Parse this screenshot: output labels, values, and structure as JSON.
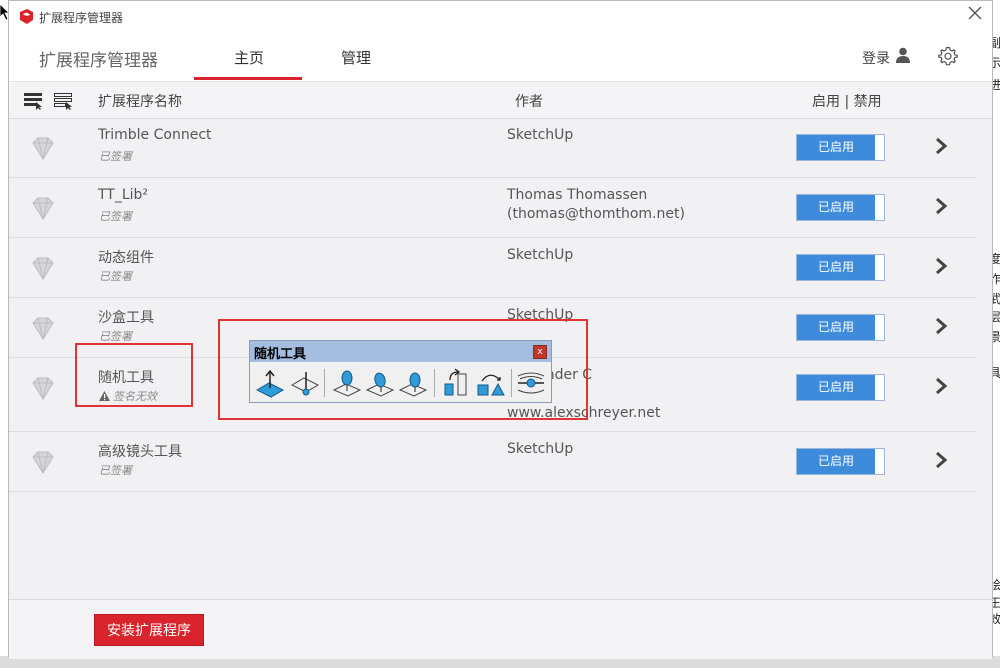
{
  "window": {
    "title": "扩展程序管理器"
  },
  "header": {
    "brand": "扩展程序管理器",
    "tabs": [
      {
        "label": "主页",
        "active": true
      },
      {
        "label": "管理",
        "active": false
      }
    ],
    "login_label": "登录"
  },
  "columns": {
    "name": "扩展程序名称",
    "author": "作者",
    "toggle": "启用 | 禁用"
  },
  "extensions": [
    {
      "name": "Trimble Connect",
      "status": "已签署",
      "author_lines": [
        "SketchUp"
      ],
      "toggle_label": "已启用"
    },
    {
      "name": "TT_Lib²",
      "status": "已签署",
      "author_lines": [
        "Thomas Thomassen",
        "(thomas@thomthom.net)"
      ],
      "toggle_label": "已启用"
    },
    {
      "name": "动态组件",
      "status": "已签署",
      "author_lines": [
        "SketchUp"
      ],
      "toggle_label": "已启用"
    },
    {
      "name": "沙盒工具",
      "status": "已签署",
      "author_lines": [
        "SketchUp"
      ],
      "toggle_label": "已启用"
    },
    {
      "name": "随机工具",
      "status": "签名无效",
      "status_warning": true,
      "author_lines": [
        "Alexander C",
        "ler,",
        "www.alexschreyer.net"
      ],
      "toggle_label": "已启用"
    },
    {
      "name": "高级镜头工具",
      "status": "已签署",
      "author_lines": [
        "SketchUp"
      ],
      "toggle_label": "已启用"
    }
  ],
  "footer": {
    "install_label": "安装扩展程序"
  },
  "floating_toolbar": {
    "title": "随机工具",
    "close_label": "x",
    "tools": [
      "move-to-plane-icon",
      "drop-to-surface-icon",
      "place-object-icon",
      "place-object-rotated-icon",
      "place-object-aligned-icon",
      "rotate-scale-icon",
      "random-transform-icon",
      "align-view-icon"
    ]
  },
  "colors": {
    "accent": "#d9232d",
    "enabled_button": "#3e8bdc",
    "toolbar_title": "#a5bde0",
    "highlight_box": "#e03434"
  },
  "background_fragments": [
    "副",
    "示",
    "进",
    "度",
    "作",
    "武",
    "层",
    "景",
    "具",
    "绘",
    "王",
    "效"
  ]
}
